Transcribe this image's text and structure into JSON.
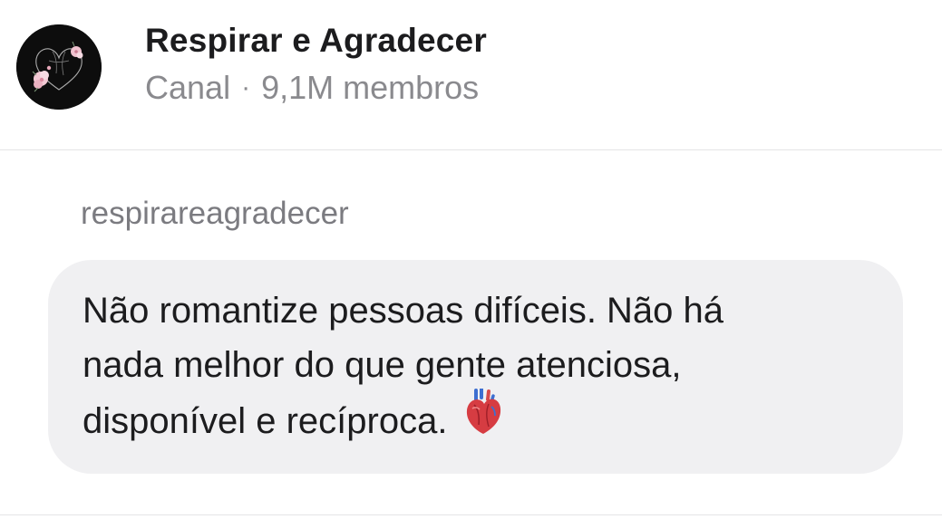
{
  "header": {
    "channel_name": "Respirar e Agradecer",
    "type_label": "Canal",
    "separator": "·",
    "members": "9,1M membros",
    "avatar_icon": "floral-heart-icon"
  },
  "message": {
    "sender": "respirareagradecer",
    "lines": [
      "Não romantize pessoas difíceis. Não há",
      "nada melhor do que gente atenciosa,",
      "disponível e recíproca."
    ],
    "emoji_icon": "anatomical-heart-icon"
  },
  "colors": {
    "bubble": "#f0f0f2",
    "text": "#1c1c1e",
    "secondary": "#8a8a8e",
    "avatar_bg": "#0d0d0d"
  }
}
